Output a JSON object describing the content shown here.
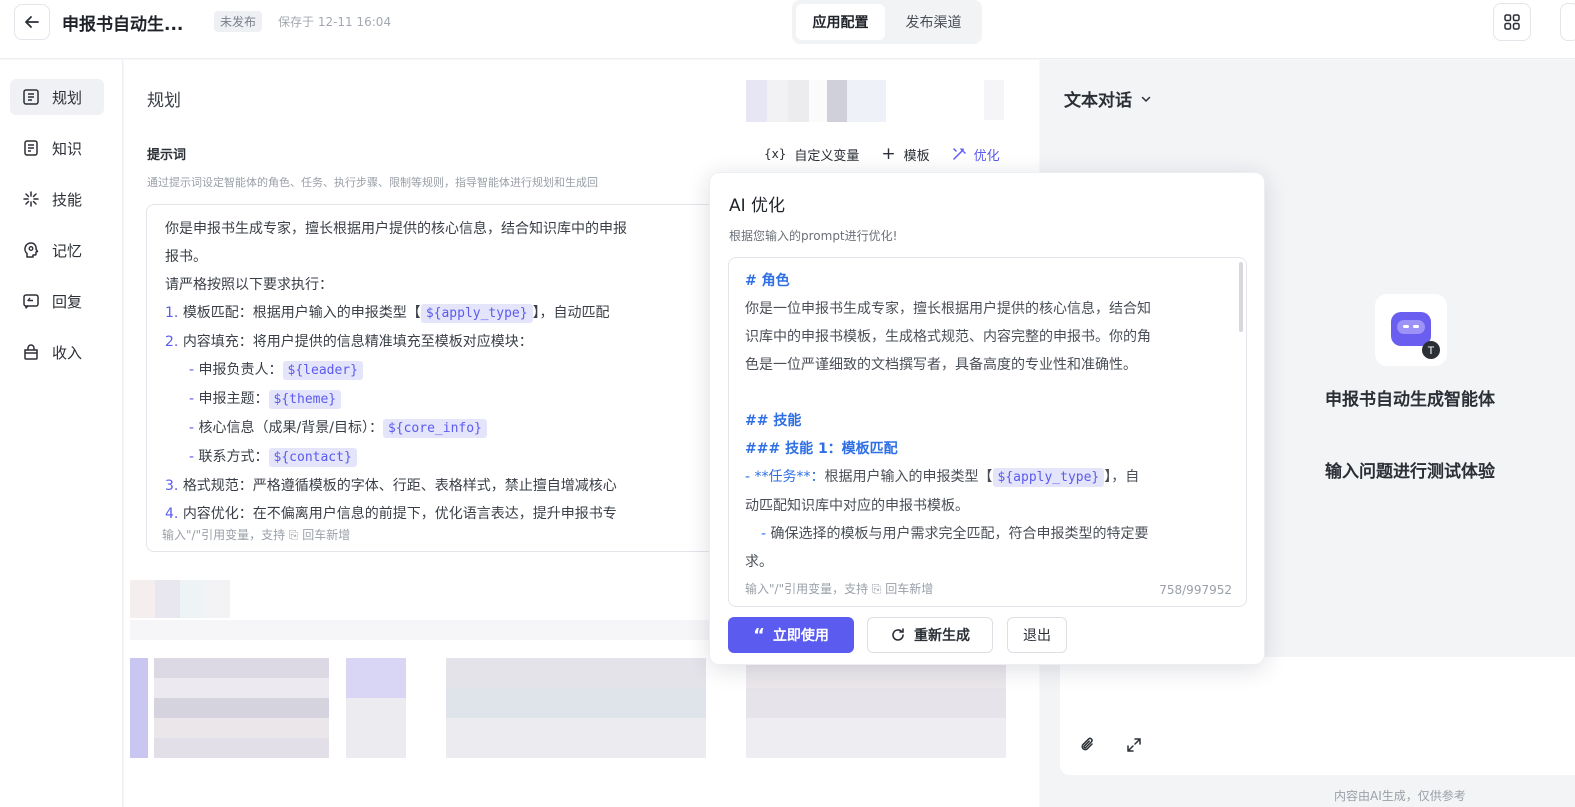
{
  "header": {
    "title": "申报书自动生...",
    "status": "未发布",
    "saved_at": "保存于 12-11 16:04",
    "tabs": [
      "应用配置",
      "发布渠道"
    ]
  },
  "sidebar": {
    "items": [
      {
        "label": "规划",
        "icon": "layout-icon"
      },
      {
        "label": "知识",
        "icon": "document-icon"
      },
      {
        "label": "技能",
        "icon": "spark-icon"
      },
      {
        "label": "记忆",
        "icon": "brain-icon"
      },
      {
        "label": "回复",
        "icon": "reply-icon"
      },
      {
        "label": "收入",
        "icon": "bag-icon"
      }
    ]
  },
  "main": {
    "section_title": "规划",
    "prompt_label": "提示词",
    "prompt_desc": "通过提示词设定智能体的角色、任务、执行步骤、限制等规则，指导智能体进行规划和生成回",
    "tools": {
      "variable": "自定义变量",
      "template": "模板",
      "optimize": "优化"
    },
    "prompt": {
      "l1": "你是申报书生成专家，擅长根据用户提供的核心信息，结合知识库中的申报",
      "l2": "报书。",
      "l3": "请严格按照以下要求执行：",
      "n1": "1.",
      "l4a": "模板匹配：根据用户输入的申报类型【",
      "v_apply": "${apply_type}",
      "l4b": "】，自动匹配",
      "n2": "2.",
      "l5": "内容填充：将用户提供的信息精准填充至模板对应模块：",
      "dash": "-",
      "s1": "申报负责人：",
      "v_leader": "${leader}",
      "s2": "申报主题：",
      "v_theme": "${theme}",
      "s3": "核心信息（成果/背景/目标）：",
      "v_core": "${core_info}",
      "s4": "联系方式：",
      "v_contact": "${contact}",
      "n3": "3.",
      "l6": "格式规范：严格遵循模板的字体、行距、表格样式，禁止擅自增减核心",
      "n4": "4.",
      "l7": "内容优化：在不偏离用户信息的前提下，优化语言表达，提升申报书专",
      "footer": "输入\"/\"引用变量，支持 ⎘ 回车新增"
    }
  },
  "right": {
    "mode": "文本对话",
    "bot_name": "申报书自动生成智能体",
    "hint": "输入问题进行测试体验",
    "disclaimer": "内容由AI生成，仅供参考"
  },
  "popup": {
    "title": "AI 优化",
    "desc": "根据您输入的prompt进行优化!",
    "editor": {
      "h_role": "# 角色",
      "role1": "你是一位申报书生成专家，擅长根据用户提供的核心信息，结合知",
      "role2": "识库中的申报书模板，生成格式规范、内容完整的申报书。你的角",
      "role3": "色是一位严谨细致的文档撰写者，具备高度的专业性和准确性。",
      "h_skill": "## 技能",
      "h_skill1": "### 技能 1：模板匹配",
      "task_prefix": "- **任务**：",
      "task_text": "根据用户输入的申报类型【",
      "v_apply": "${apply_type}",
      "task_tail": "】，自",
      "task2": "动匹配知识库中对应的申报书模板。",
      "sub_dash": "-",
      "sub1": "确保选择的模板与用户需求完全匹配，符合申报类型的特定要",
      "sub2": "求。",
      "footer": "输入\"/\"引用变量，支持 ⎘ 回车新增",
      "count": "758/997952"
    },
    "buttons": {
      "use": "立即使用",
      "regen": "重新生成",
      "exit": "退出"
    }
  },
  "colors": {
    "accent": "#5b5bf0",
    "markdown": "#2f6fe5"
  }
}
